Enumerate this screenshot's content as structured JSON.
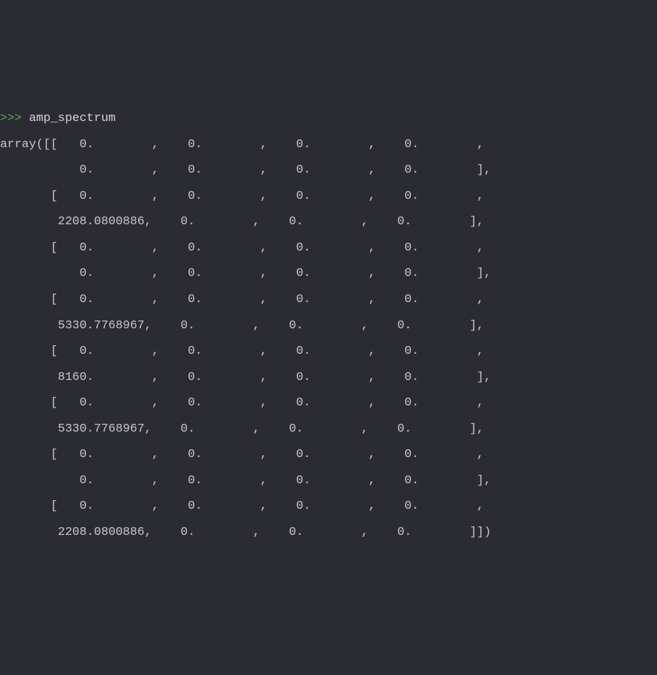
{
  "prompt": ">>> ",
  "command": "amp_spectrum",
  "lines": [
    "array([[   0.        ,    0.        ,    0.        ,    0.        ,",
    "           0.        ,    0.        ,    0.        ,    0.        ],",
    "       [   0.        ,    0.        ,    0.        ,    0.        ,",
    "        2208.0800886,    0.        ,    0.        ,    0.        ],",
    "       [   0.        ,    0.        ,    0.        ,    0.        ,",
    "           0.        ,    0.        ,    0.        ,    0.        ],",
    "       [   0.        ,    0.        ,    0.        ,    0.        ,",
    "        5330.7768967,    0.        ,    0.        ,    0.        ],",
    "       [   0.        ,    0.        ,    0.        ,    0.        ,",
    "        8160.        ,    0.        ,    0.        ,    0.        ],",
    "       [   0.        ,    0.        ,    0.        ,    0.        ,",
    "        5330.7768967,    0.        ,    0.        ,    0.        ],",
    "       [   0.        ,    0.        ,    0.        ,    0.        ,",
    "           0.        ,    0.        ,    0.        ,    0.        ],",
    "       [   0.        ,    0.        ,    0.        ,    0.        ,",
    "        2208.0800886,    0.        ,    0.        ,    0.        ]])"
  ]
}
